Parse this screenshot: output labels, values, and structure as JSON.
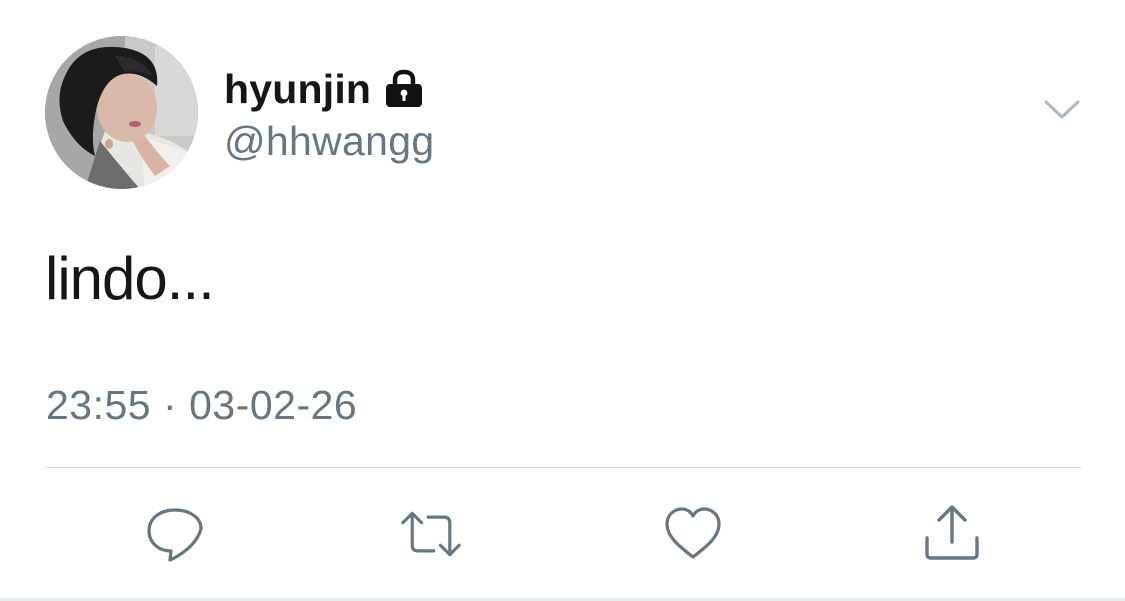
{
  "user": {
    "display_name": "hyunjin",
    "handle": "@hhwangg",
    "protected_icon": "lock-icon",
    "avatar": "profile-photo"
  },
  "tweet": {
    "text": "lindo...",
    "time": "23:55",
    "separator": "·",
    "date": "03-02-26"
  },
  "menu_icon": "chevron-down-icon",
  "actions": [
    {
      "name": "reply",
      "icon": "reply-icon"
    },
    {
      "name": "retweet",
      "icon": "retweet-icon"
    },
    {
      "name": "like",
      "icon": "heart-icon"
    },
    {
      "name": "share",
      "icon": "share-icon"
    }
  ],
  "colors": {
    "text_primary": "#14171a",
    "text_secondary": "#657786",
    "divider": "#d6dadd"
  }
}
